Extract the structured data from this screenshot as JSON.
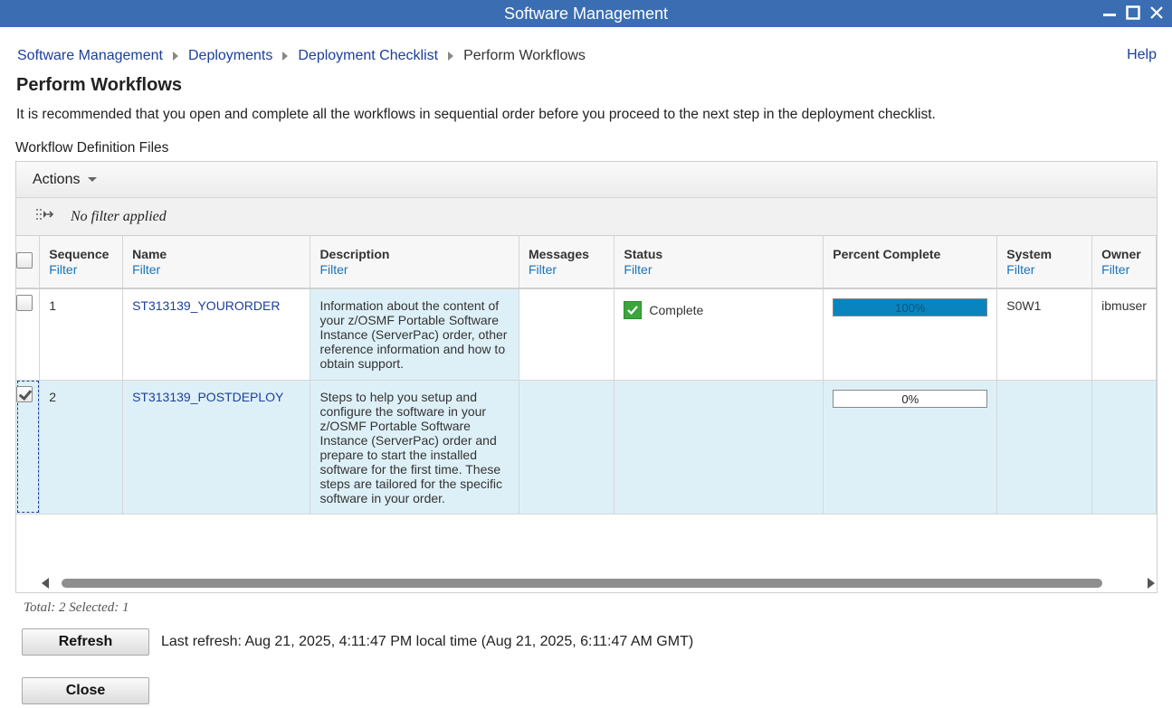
{
  "window": {
    "title": "Software Management"
  },
  "breadcrumb": {
    "items": [
      "Software Management",
      "Deployments",
      "Deployment Checklist"
    ],
    "current": "Perform Workflows"
  },
  "help_label": "Help",
  "page": {
    "title": "Perform Workflows",
    "intro": "It is recommended that you open and complete all the workflows in sequential order before you proceed to the next step in the deployment checklist.",
    "section_label": "Workflow Definition Files"
  },
  "toolbar": {
    "actions_label": "Actions",
    "filter_status": "No filter applied"
  },
  "table": {
    "filter_label": "Filter",
    "columns": {
      "sequence": "Sequence",
      "name": "Name",
      "description": "Description",
      "messages": "Messages",
      "status": "Status",
      "percent": "Percent Complete",
      "system": "System",
      "owner": "Owner"
    },
    "rows": [
      {
        "selected": false,
        "sequence": "1",
        "name": "ST313139_YOURORDER",
        "description": "Information about the content of your z/OSMF Portable Software Instance (ServerPac) order, other reference information and how to obtain support.",
        "messages": "",
        "status": "Complete",
        "status_icon": "check-icon",
        "percent": 100,
        "percent_label": "100%",
        "system": "S0W1",
        "owner": "ibmuser"
      },
      {
        "selected": true,
        "sequence": "2",
        "name": "ST313139_POSTDEPLOY",
        "description": "Steps to help you setup and configure the software in your z/OSMF Portable Software Instance (ServerPac) order and prepare to start the installed software for the first time. These steps are tailored for the specific software in your order.",
        "messages": "",
        "status": "",
        "percent": 0,
        "percent_label": "0%",
        "system": "",
        "owner": ""
      }
    ]
  },
  "footer": {
    "totals": "Total: 2 Selected: 1",
    "refresh_label": "Refresh",
    "last_refresh": "Last refresh: Aug 21, 2025, 4:11:47 PM local time (Aug 21, 2025, 6:11:47 AM GMT)",
    "close_label": "Close"
  },
  "colors": {
    "titlebar": "#3b6db3",
    "link": "#1c3f9e",
    "progress_fill": "#0a84bf",
    "selected_row": "#def0f7",
    "status_complete": "#3da53d"
  }
}
